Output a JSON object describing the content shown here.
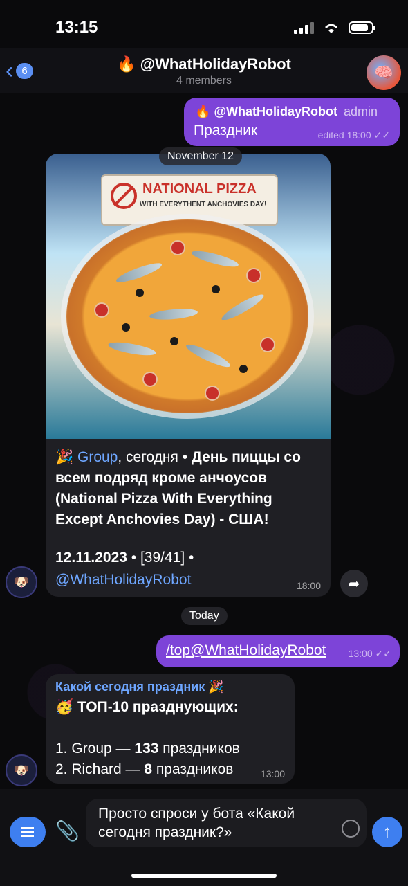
{
  "status": {
    "time": "13:15"
  },
  "header": {
    "back_count": "6",
    "title": "🔥 @WhatHolidayRobot",
    "subtitle": "4 members"
  },
  "messages": {
    "msg1": {
      "emoji": "🔥",
      "name": "@WhatHolidayRobot",
      "tag": "admin",
      "text": "Праздник",
      "meta": "edited 18:00"
    },
    "date_pill": "November 12",
    "post": {
      "banner_title": "NATIONAL PIZZA",
      "banner_sub": "WITH EVERYTHENT ANCHOVIES DAY!",
      "party_emoji": "🎉",
      "group_link": "Group",
      "lead": ", сегодня • ",
      "bold": "День пиццы со всем подряд кроме анчоусов (National Pizza With Everything Except Anchovies Day) - США!",
      "date_line": "12.11.2023",
      "date_rest": " • [39/41] •",
      "bot_link": "@WhatHolidayRobot",
      "time": "18:00"
    },
    "today_pill": "Today",
    "cmd": {
      "text": "/top@WhatHolidayRobot",
      "time": "13:00"
    },
    "top": {
      "header": "Какой сегодня праздник 🎉",
      "title": "🥳 ТОП-10 празднующих:",
      "row1_name": "1. Group — ",
      "row1_num": "133",
      "row1_unit": " праздников",
      "row2_name": "2. Richard — ",
      "row2_num": "8",
      "row2_unit": " праздников",
      "time": "13:00"
    }
  },
  "composer": {
    "text": "Просто спроси у бота «Какой сегодня праздник?»"
  },
  "colors": {
    "accent": "#3e7ff0",
    "outgoing": "#7d44d8",
    "incoming": "#1f1f24",
    "link": "#6ea6ff"
  }
}
